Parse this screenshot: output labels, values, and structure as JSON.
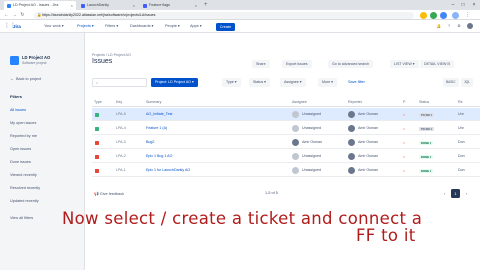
{
  "browser": {
    "tabs": [
      {
        "label": "LD Project AO - Issues - Jira",
        "color": "#2684ff"
      },
      {
        "label": "LaunchDarkly",
        "color": "#405bff"
      },
      {
        "label": "Feature flags",
        "color": "#405bff"
      }
    ],
    "url": "https://launchdarkly2022.atlassian.net/jira/software/c/projects/LA/issues"
  },
  "jira_nav": {
    "logo": "Jira",
    "items": [
      "Your work ▾",
      "Projects ▾",
      "Filters ▾",
      "Dashboards ▾",
      "People ▾",
      "Apps ▾"
    ],
    "create_label": "Create"
  },
  "sidebar": {
    "project_name": "LD Project AO",
    "project_type": "Software project",
    "back_label": "Back to project",
    "filters_heading": "Filters",
    "filters": [
      "All issues",
      "My open issues",
      "Reported by me",
      "Open issues",
      "Done issues",
      "Viewed recently",
      "Resolved recently",
      "Updated recently"
    ],
    "view_all": "View all filters"
  },
  "header": {
    "breadcrumb": "Projects  /  LD Project AO",
    "title": "Issues",
    "buttons": [
      "Share",
      "Export issues",
      "Go to advanced search",
      "LIST VIEW ▾",
      "DETAIL VIEW ⊟"
    ]
  },
  "toolbar": {
    "search_placeholder": "",
    "project_pill": "Project: LD Project AO ▾",
    "pills": [
      "Type ▾",
      "Status ▾",
      "Assignee ▾",
      "More ▾"
    ],
    "save_filter": "Save filter",
    "basic": "BASIC",
    "jql": "JQL"
  },
  "table": {
    "columns": [
      "Type",
      "Key",
      "Summary",
      "Assignee",
      "Reporter",
      "P",
      "Status",
      "Re"
    ],
    "rows": [
      {
        "type_color": "#36b37e",
        "key": "LPA-5",
        "summary": "AO_Initiate_Test",
        "assignee": "Unassigned",
        "reporter": "Amir Osman",
        "status": "TO DO ▾",
        "status_kind": "todo",
        "resolution": "Unr"
      },
      {
        "type_color": "#36b37e",
        "key": "LPA-4",
        "summary": "Feature 1 (A)",
        "assignee": "Unassigned",
        "reporter": "Amir Osman",
        "status": "TO DO ▾",
        "status_kind": "todo",
        "resolution": "Unr"
      },
      {
        "type_color": "#e5493a",
        "key": "LPA-3",
        "summary": "Bug2",
        "assignee": "Amir Osman",
        "reporter": "Amir Osman",
        "status": "DONE ▾",
        "status_kind": "done",
        "resolution": "Don"
      },
      {
        "type_color": "#e5493a",
        "key": "LPA-2",
        "summary": "Epic 1 Bug 1 AO",
        "assignee": "Unassigned",
        "reporter": "Amir Osman",
        "status": "DONE ▾",
        "status_kind": "done",
        "resolution": "Don"
      },
      {
        "type_color": "#e5493a",
        "key": "LPA-1",
        "summary": "Epic 1 for LaunchDarkly AO",
        "assignee": "Unassigned",
        "reporter": "Amir Osman",
        "status": "DONE ▾",
        "status_kind": "done",
        "resolution": "Don"
      }
    ]
  },
  "footer": {
    "feedback": "Give feedback",
    "count": "1-5 of 5",
    "current_page": "1"
  },
  "caption": {
    "line1": "Now select / create a ticket and connect a",
    "line2": "FF to it"
  }
}
